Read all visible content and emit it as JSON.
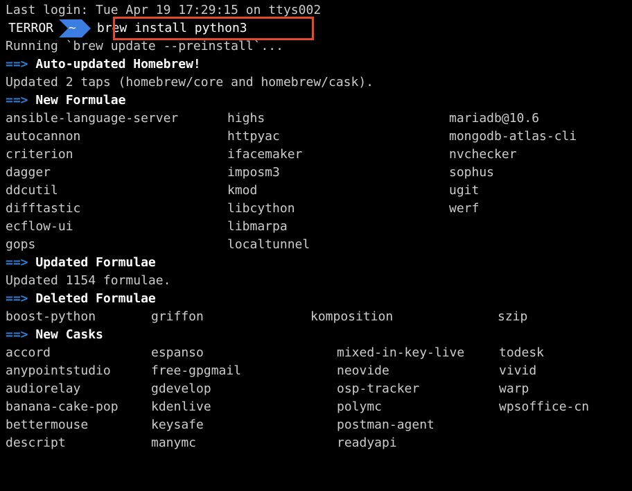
{
  "last_login": "Last login: Tue Apr 19 17:29:15 on ttys002",
  "prompt": {
    "host": "TERROR",
    "cwd": "~",
    "command": "brew install python3"
  },
  "running": "Running `brew update --preinstall`...",
  "arrow": "==>",
  "sections": {
    "auto_updated": "Auto-updated Homebrew!",
    "updated_taps": "Updated 2 taps (homebrew/core and homebrew/cask).",
    "new_formulae": "New Formulae",
    "updated_formulae": "Updated Formulae",
    "updated_count": "Updated 1154 formulae.",
    "deleted_formulae": "Deleted Formulae",
    "new_casks": "New Casks"
  },
  "new_formulae_cols": [
    [
      "ansible-language-server",
      "autocannon",
      "criterion",
      "dagger",
      "ddcutil",
      "difftastic",
      "ecflow-ui",
      "gops"
    ],
    [
      "highs",
      "httpyac",
      "ifacemaker",
      "imposm3",
      "kmod",
      "libcython",
      "libmarpa",
      "localtunnel"
    ],
    [
      "mariadb@10.6",
      "mongodb-atlas-cli",
      "nvchecker",
      "sophus",
      "ugit",
      "werf",
      "",
      ""
    ]
  ],
  "deleted_formulae_cols": [
    [
      "boost-python"
    ],
    [
      "griffon"
    ],
    [
      "komposition"
    ],
    [
      "szip"
    ]
  ],
  "new_casks_cols": [
    [
      "accord",
      "anypointstudio",
      "audiorelay",
      "banana-cake-pop",
      "bettermouse",
      "descript"
    ],
    [
      "espanso",
      "free-gpgmail",
      "gdevelop",
      "kdenlive",
      "keysafe",
      "manymc"
    ],
    [
      "mixed-in-key-live",
      "neovide",
      "osp-tracker",
      "polymc",
      "postman-agent",
      "readyapi"
    ],
    [
      "todesk",
      "vivid",
      "warp",
      "wpsoffice-cn",
      "",
      ""
    ]
  ]
}
